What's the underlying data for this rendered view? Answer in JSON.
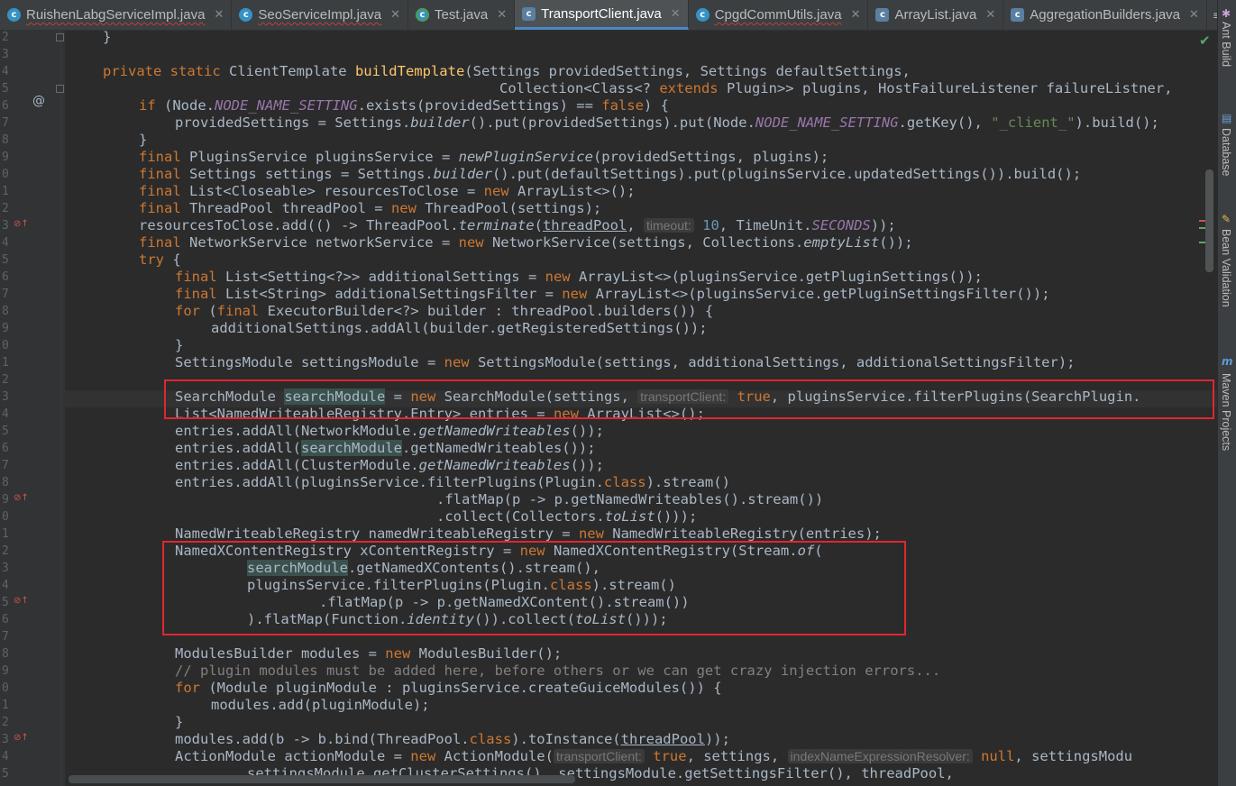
{
  "tabs": [
    {
      "label": "RuishenLabgServiceImpl.java",
      "icon": "class-icon",
      "active": false,
      "warn": true
    },
    {
      "label": "SeoServiceImpl.java",
      "icon": "class-icon",
      "active": false,
      "warn": true
    },
    {
      "label": "Test.java",
      "icon": "test-class-icon",
      "active": false,
      "warn": false
    },
    {
      "label": "TransportClient.java",
      "icon": "library-class-icon",
      "active": true,
      "warn": false
    },
    {
      "label": "CpgdCommUtils.java",
      "icon": "class-icon",
      "active": false,
      "warn": true
    },
    {
      "label": "ArrayList.java",
      "icon": "library-class-icon",
      "active": false,
      "warn": false
    },
    {
      "label": "AggregationBuilders.java",
      "icon": "library-class-icon",
      "active": false,
      "warn": false
    }
  ],
  "tab_overflow": "≡",
  "right_panels": [
    "Ant Build",
    "Database",
    "Bean Validation",
    "Maven Projects"
  ],
  "line_numbers": [
    "2",
    "3",
    "4",
    "5",
    "6",
    "7",
    "8",
    "9",
    "0",
    "1",
    "2",
    "3",
    "4",
    "5",
    "6",
    "7",
    "8",
    "9",
    "0",
    "1",
    "2",
    "3",
    "4",
    "5",
    "6",
    "7",
    "8",
    "9",
    "0",
    "1",
    "2",
    "3",
    "4",
    "5",
    "6",
    "7",
    "8",
    "9",
    "0",
    "1",
    "2",
    "3",
    "4",
    "5"
  ],
  "hints": {
    "timeout": "timeout:",
    "transportClient1": "transportClient:",
    "transportClient2": "transportClient:",
    "indexNameExpressionResolver": "indexNameExpressionResolver:"
  },
  "code": {
    "l0": "}",
    "l2a": "private static ",
    "l2b": "ClientTemplate ",
    "l2c": "buildTemplate",
    "l2d": "(Settings providedSettings, Settings defaultSettings,",
    "l3a": "Collection<Class<? ",
    "l3b": "extends ",
    "l3c": "Plugin>> plugins, HostFailureListener failureListner,",
    "l4a": "if ",
    "l4b": "(Node.",
    "l4c": "NODE_NAME_SETTING",
    "l4d": ".exists(providedSettings) == ",
    "l4e": "false",
    "l4f": ") {",
    "l5a": "providedSettings = Settings.",
    "l5b": "builder",
    "l5c": "().put(providedSettings).put(Node.",
    "l5d": "NODE_NAME_SETTING",
    "l5e": ".getKey(), ",
    "l5f": "\"_client_\"",
    "l5g": ").build();",
    "l6": "}",
    "l7a": "final ",
    "l7b": "PluginsService pluginsService = ",
    "l7c": "newPluginService",
    "l7d": "(providedSettings, plugins);",
    "l8a": "final ",
    "l8b": "Settings settings = Settings.",
    "l8c": "builder",
    "l8d": "().put(defaultSettings).put(pluginsService.updatedSettings()).build();",
    "l9a": "final ",
    "l9b": "List<Closeable> resourcesToClose = ",
    "l9c": "new ",
    "l9d": "ArrayList<>();",
    "l10a": "final ",
    "l10b": "ThreadPool threadPool = ",
    "l10c": "new ",
    "l10d": "ThreadPool(settings);",
    "l11a": "resourcesToClose.add(() -> ThreadPool.",
    "l11b": "terminate",
    "l11c": "(",
    "l11d": "threadPool",
    "l11e": ", ",
    "l11f": "10",
    "l11g": ", TimeUnit.",
    "l11h": "SECONDS",
    "l11i": "));",
    "l12a": "final ",
    "l12b": "NetworkService networkService = ",
    "l12c": "new ",
    "l12d": "NetworkService(settings, Collections.",
    "l12e": "emptyList",
    "l12f": "());",
    "l13a": "try ",
    "l13b": "{",
    "l14a": "final ",
    "l14b": "List<Setting<?>> additionalSettings = ",
    "l14c": "new ",
    "l14d": "ArrayList<>(pluginsService.getPluginSettings());",
    "l15a": "final ",
    "l15b": "List<String> additionalSettingsFilter = ",
    "l15c": "new ",
    "l15d": "ArrayList<>(pluginsService.getPluginSettingsFilter());",
    "l16a": "for ",
    "l16b": "(",
    "l16c": "final ",
    "l16d": "ExecutorBuilder<?> builder : threadPool.builders()) {",
    "l17": "additionalSettings.addAll(builder.getRegisteredSettings());",
    "l18": "}",
    "l19a": "SettingsModule settingsModule = ",
    "l19b": "new ",
    "l19c": "SettingsModule(settings, additionalSettings, additionalSettingsFilter);",
    "l21a": "SearchModule ",
    "l21b": "searchModule",
    "l21c": " = ",
    "l21d": "new ",
    "l21e": "SearchModule(settings, ",
    "l21f": "true",
    "l21g": ", pluginsService.filterPlugins(SearchPlugin.",
    "l22a": "List<NamedWriteableRegistry.Entry> entries = ",
    "l22b": "new ",
    "l22c": "ArrayList<>();",
    "l23a": "entries.addAll(NetworkModule.",
    "l23b": "getNamedWriteables",
    "l23c": "());",
    "l24a": "entries.addAll(",
    "l24b": "searchModule",
    "l24c": ".getNamedWriteables());",
    "l25a": "entries.addAll(ClusterModule.",
    "l25b": "getNamedWriteables",
    "l25c": "());",
    "l26a": "entries.addAll(pluginsService.filterPlugins(Plugin.",
    "l26b": "class",
    "l26c": ").stream()",
    "l27": ".flatMap(p -> p.getNamedWriteables().stream())",
    "l28a": ".collect(Collectors.",
    "l28b": "toList",
    "l28c": "()));",
    "l29a": "NamedWriteableRegistry namedWriteableRegistry = ",
    "l29b": "new ",
    "l29c": "NamedWriteableRegistry(entries);",
    "l30a": "NamedXContentRegistry xContentRegistry = ",
    "l30b": "new ",
    "l30c": "NamedXContentRegistry(Stream.",
    "l30d": "of",
    "l30e": "(",
    "l31a": "searchModule",
    "l31b": ".getNamedXContents().stream(),",
    "l32a": "pluginsService.filterPlugins(Plugin.",
    "l32b": "class",
    "l32c": ").stream()",
    "l33": ".flatMap(p -> p.getNamedXContent().stream())",
    "l34a": ").flatMap(Function.",
    "l34b": "identity",
    "l34c": "()).collect(",
    "l34d": "toList",
    "l34e": "()));",
    "l36a": "ModulesBuilder modules = ",
    "l36b": "new ",
    "l36c": "ModulesBuilder();",
    "l37": "// plugin modules must be added here, before others or we can get crazy injection errors...",
    "l38a": "for ",
    "l38b": "(Module pluginModule : pluginsService.createGuiceModules()) {",
    "l39": "modules.add(pluginModule);",
    "l40": "}",
    "l41a": "modules.add(b -> b.bind(ThreadPool.",
    "l41b": "class",
    "l41c": ").toInstance(",
    "l41d": "threadPool",
    "l41e": "));",
    "l42a": "ActionModule actionModule = ",
    "l42b": "new ",
    "l42c": "ActionModule(",
    "l42d": "true",
    "l42e": ", settings, ",
    "l42f": "null",
    "l42g": ", settingsModu",
    "l43": "settingsModule.getClusterSettings(), settingsModule.getSettingsFilter(), threadPool,"
  },
  "colors": {
    "keyword": "#cc7832",
    "method": "#ffc66d",
    "static": "#9876aa",
    "string": "#6a8759",
    "number": "#6897bb",
    "comment": "#808080",
    "text": "#a9b7c6",
    "highlight_box": "#e0262f"
  }
}
